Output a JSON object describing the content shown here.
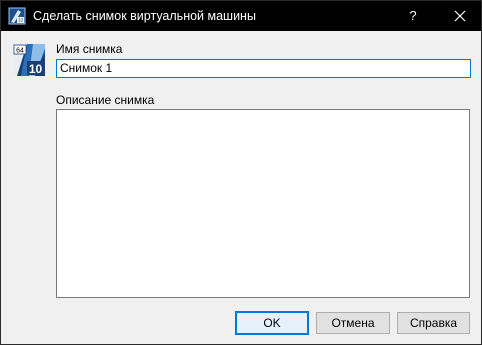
{
  "window": {
    "title": "Сделать снимок виртуальной машины",
    "help_glyph": "?",
    "close_icon": "close-icon",
    "app_icon": "virtualbox-icon"
  },
  "vm_icon": {
    "icon": "windows-10-64-icon",
    "badge_top": "64",
    "badge_bottom": "10"
  },
  "form": {
    "name_label": "Имя снимка",
    "name_value": "Снимок 1",
    "description_label": "Описание снимка",
    "description_value": ""
  },
  "buttons": {
    "ok": "OK",
    "cancel": "Отмена",
    "help": "Справка"
  },
  "colors": {
    "titlebar": "#000000",
    "focus_accent": "#0078d7",
    "dialog_bg": "#f0f0f0"
  }
}
